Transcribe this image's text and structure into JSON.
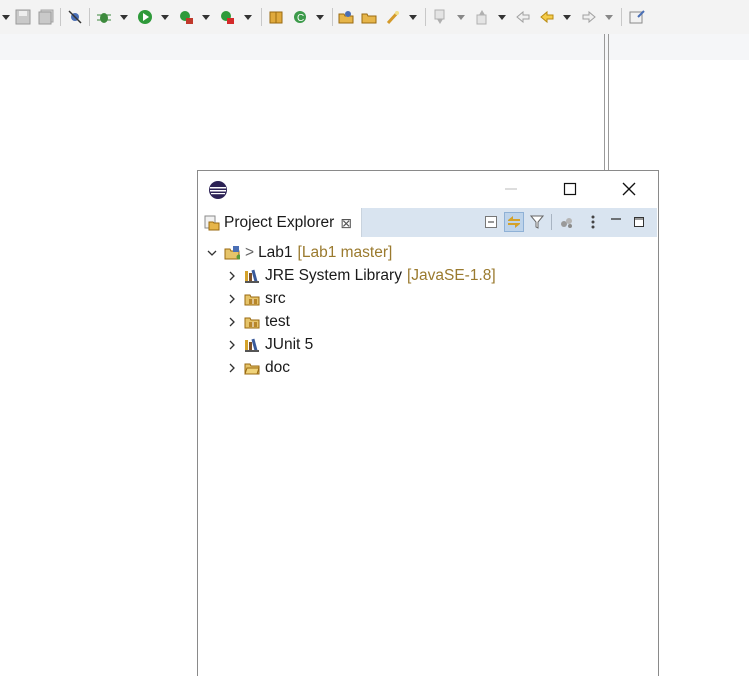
{
  "toolbar": {
    "icons": [
      "dropdown-arrow",
      "save",
      "save-all",
      "skip-breakpoints",
      "debug",
      "run",
      "coverage",
      "external-tools",
      "new-java-package",
      "new-class",
      "open-type",
      "open-task",
      "search",
      "next-annotation",
      "prev-annotation",
      "last-edit",
      "back",
      "forward",
      "pin-editor"
    ]
  },
  "window": {
    "title_icon": "eclipse-logo",
    "minimize_glyph": "—",
    "maximize_glyph": "☐",
    "close_glyph": "✕"
  },
  "view": {
    "tab_label": "Project Explorer",
    "tab_close": "✕",
    "tab_close_glyph": "⊠"
  },
  "tree": {
    "project": {
      "prefix": ">",
      "label": "Lab1",
      "decoration": "[Lab1 master]"
    },
    "children": [
      {
        "label": "JRE System Library",
        "decoration": "[JavaSE-1.8]",
        "icon": "library-icon"
      },
      {
        "label": "src",
        "decoration": "",
        "icon": "source-folder-icon"
      },
      {
        "label": "test",
        "decoration": "",
        "icon": "source-folder-icon"
      },
      {
        "label": "JUnit 5",
        "decoration": "",
        "icon": "library-icon"
      },
      {
        "label": "doc",
        "decoration": "",
        "icon": "folder-icon"
      }
    ]
  },
  "colors": {
    "tabbar": "#d9e4f0",
    "decoration": "#9a7a2e",
    "toolbar": "#f3f3f3"
  }
}
